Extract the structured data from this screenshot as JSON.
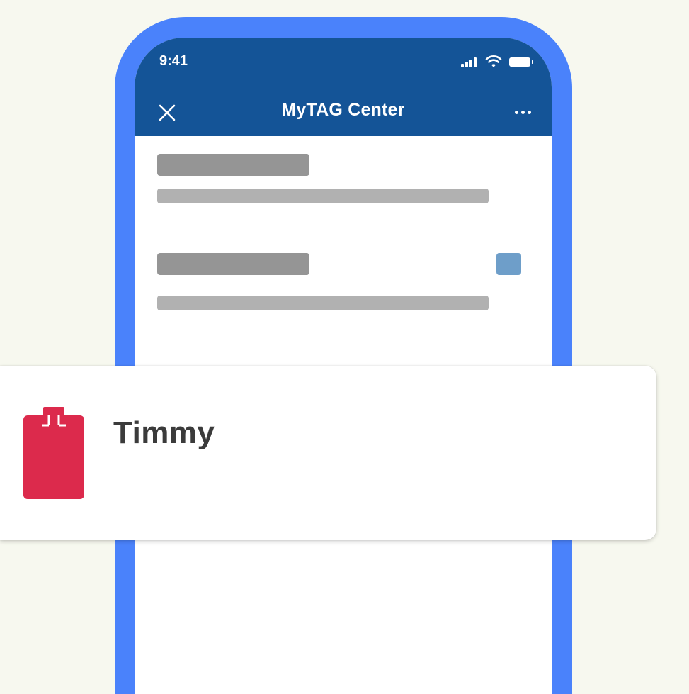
{
  "status_bar": {
    "time": "9:41"
  },
  "header": {
    "title": "MyTAG Center",
    "close_icon": "close-icon",
    "more_icon": "more-horizontal-icon"
  },
  "tag_card": {
    "name": "Timmy",
    "icon": "tag-icon",
    "icon_color": "#dc2a4c"
  },
  "colors": {
    "background": "#f7f8ef",
    "phone_frame": "#4a82fb",
    "header": "#145497",
    "accent_square": "#6e9ec9"
  }
}
